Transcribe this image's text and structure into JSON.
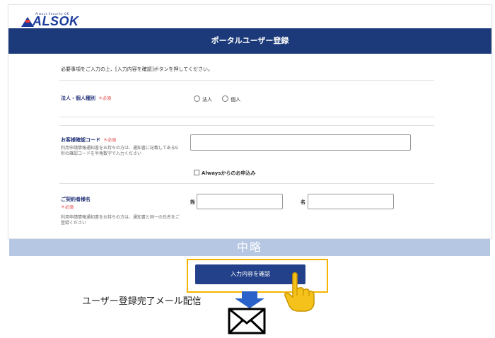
{
  "brand": {
    "tagline": "Always Security OK",
    "name": "ALSOK"
  },
  "header": {
    "title": "ポータルユーザー登録"
  },
  "intro": "必要事項をご入力の上、[入力内容を確認]ボタンを押してください。",
  "required_label": "＊必須",
  "fields": {
    "corporate_type": {
      "label": "法人・個人種別",
      "options": [
        "法人",
        "個人"
      ]
    },
    "customer_code": {
      "label": "お客様確認コード",
      "note": "利用申請情報通知書をお持ちの方は、通知書に記載してある9桁の確認コードを半角数字で入力ください",
      "checkbox_label": "Alwaysからのお申込み"
    },
    "contractor_name": {
      "label": "ご契約者様名",
      "note": "利用申請情報通知書をお持ちの方は、通知書と同一の氏名をご登録ください",
      "last_name_label": "姓",
      "first_name_label": "名"
    }
  },
  "omitted": "中略",
  "confirm_button": "入力内容を確認",
  "caption": "ユーザー登録完了メール配信",
  "icons": {
    "hand": "pointing-hand-icon",
    "arrow": "down-arrow-icon",
    "envelope": "envelope-icon"
  },
  "colors": {
    "header": "#1c3a7a",
    "button": "#23418a",
    "highlight": "#f4b400",
    "required": "#e23b3b"
  }
}
